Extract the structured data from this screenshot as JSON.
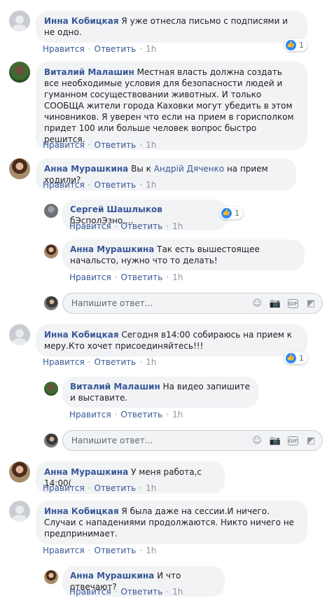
{
  "actions": {
    "like": "Нравится",
    "reply": "Ответить"
  },
  "reply_placeholder": "Напишите ответ...",
  "comments": [
    {
      "author": "Инна Кобицкая",
      "text": "Я уже отнесла письмо с подписями и не одно.",
      "time": "1h",
      "reactions": "1"
    },
    {
      "author": "Виталий Малашин",
      "text": "Местная власть должна создать все необходимые условия для безопасности людей и гуманном сосуществовании животных. И только СООБЩА жители города Каховки могут убедить в этом чиновников. Я уверен что если на прием в горисполком придет 100 или больше человек вопрос быстро решится.",
      "time": "1h"
    },
    {
      "author": "Анна Мурашкина",
      "text_before": "Вы к ",
      "mention": "Андрій Дяченко",
      "text_after": " на прием ходили?",
      "time": "1h",
      "replies": [
        {
          "author": "Сергей Шашлыков",
          "text": "бЭсполЭзно....",
          "time": "1h",
          "reactions": "1"
        },
        {
          "author": "Анна Мурашкина",
          "text": "Так есть вышестоящее начальсто, нужно что то делать!",
          "time": "1h"
        }
      ]
    },
    {
      "author": "Инна Кобицкая",
      "text": "Сегодня в14:00 собираюсь на прием к меру.Кто хочет присоединяйтесь!!!",
      "time": "1h",
      "reactions": "1",
      "replies": [
        {
          "author": "Виталий Малашин",
          "text": "На видео запишите и выставите.",
          "time": "1h"
        }
      ]
    },
    {
      "author": "Анна Мурашкина",
      "text": "У меня работа,с 14:00(",
      "time": "1h"
    },
    {
      "author": "Инна Кобицкая",
      "text": "Я была даже на сессии.И ничего. Случаи с нападениями продолжаются. Никто ничего не предпринимает.",
      "time": "1h",
      "replies": [
        {
          "author": "Анна Мурашкина",
          "text": "И что отвечают?",
          "time": "1h"
        }
      ]
    }
  ]
}
